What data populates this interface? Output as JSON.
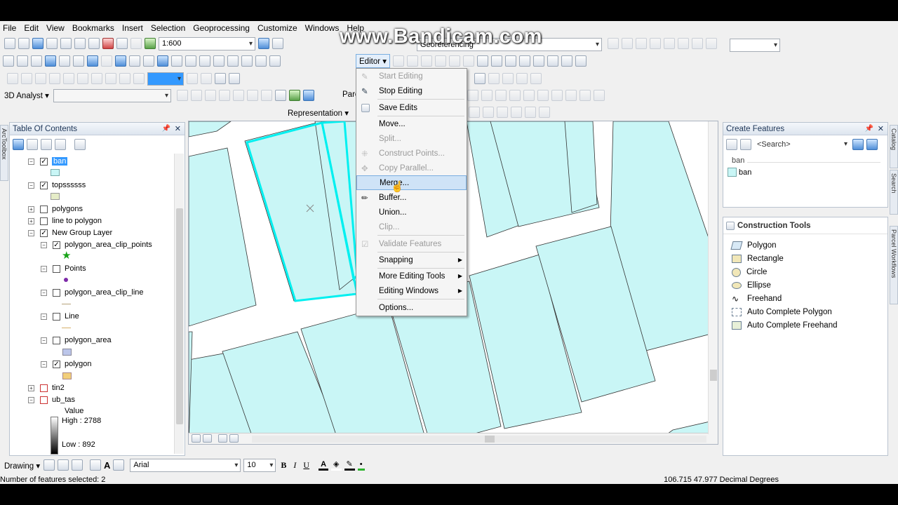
{
  "menu": [
    "File",
    "Edit",
    "View",
    "Bookmarks",
    "Insert",
    "Selection",
    "Geoprocessing",
    "Customize",
    "Windows",
    "Help"
  ],
  "watermark": "www.Bandicam.com",
  "toolbar": {
    "scale": "1:600",
    "editor_label": "Editor ▾",
    "georef_label": "Georeferencing",
    "analyst_label": "3D Analyst ▾",
    "parc_label": "Parc",
    "representation_label": "Representation ▾",
    "drawing_label": "Drawing ▾",
    "font_name": "Arial",
    "font_size": "10",
    "bold": "B",
    "italic": "I",
    "underline": "U"
  },
  "toc": {
    "title": "Table Of Contents",
    "layers": [
      {
        "label": "ban",
        "checked": true,
        "expand": "−"
      },
      {
        "label": "topssssss",
        "checked": true,
        "expand": "−"
      },
      {
        "label": "polygons",
        "checked": false,
        "expand": "+"
      },
      {
        "label": "line to polygon",
        "checked": false,
        "expand": "+"
      },
      {
        "label": "New Group Layer",
        "checked": true,
        "expand": "−"
      },
      {
        "label": "polygon_area_clip_points",
        "checked": true,
        "expand": "−"
      },
      {
        "label": "Points",
        "checked": false,
        "expand": "−"
      },
      {
        "label": "polygon_area_clip_line",
        "checked": false,
        "expand": "−"
      },
      {
        "label": "Line",
        "checked": false,
        "expand": "−"
      },
      {
        "label": "polygon_area",
        "checked": false,
        "expand": "−"
      },
      {
        "label": "polygon",
        "checked": true,
        "expand": "−"
      },
      {
        "label": "tin2",
        "checked": false,
        "expand": "+"
      },
      {
        "label": "ub_tas",
        "checked": false,
        "expand": "−"
      }
    ],
    "raster_value_label": "Value",
    "raster_high": "High : 2788",
    "raster_low": "Low : 892"
  },
  "side_tabs": {
    "left": "ArcToolbox",
    "right1": "Catalog",
    "right2": "Search",
    "right3": "Parcel Workflows"
  },
  "editor_menu": {
    "items": [
      {
        "label": "Start Editing",
        "disabled": true
      },
      {
        "label": "Stop Editing",
        "disabled": false
      },
      {
        "label": "Save Edits",
        "disabled": false
      },
      {
        "label": "Move...",
        "disabled": false
      },
      {
        "label": "Split...",
        "disabled": true
      },
      {
        "label": "Construct Points...",
        "disabled": true
      },
      {
        "label": "Copy Parallel...",
        "disabled": true
      },
      {
        "label": "Merge...",
        "disabled": false
      },
      {
        "label": "Buffer...",
        "disabled": false
      },
      {
        "label": "Union...",
        "disabled": false
      },
      {
        "label": "Clip...",
        "disabled": true
      },
      {
        "label": "Validate Features",
        "disabled": true
      },
      {
        "label": "Snapping",
        "disabled": false
      },
      {
        "label": "More Editing Tools",
        "disabled": false
      },
      {
        "label": "Editing Windows",
        "disabled": false
      },
      {
        "label": "Options...",
        "disabled": false
      }
    ],
    "highlighted": "Merge..."
  },
  "create_features": {
    "title": "Create Features",
    "search_placeholder": "<Search>",
    "group_label": "ban",
    "template_label": "ban"
  },
  "construction_tools": {
    "title": "Construction Tools",
    "tools": [
      "Polygon",
      "Rectangle",
      "Circle",
      "Ellipse",
      "Freehand",
      "Auto Complete Polygon",
      "Auto Complete Freehand"
    ]
  },
  "status": {
    "selected": "Number of features selected: 2",
    "coords": "106.715  47.977 Decimal Degrees"
  },
  "colors": {
    "map_fill": "#c9f6f6",
    "selection": "#00ffff",
    "accent": "#3399ff"
  }
}
